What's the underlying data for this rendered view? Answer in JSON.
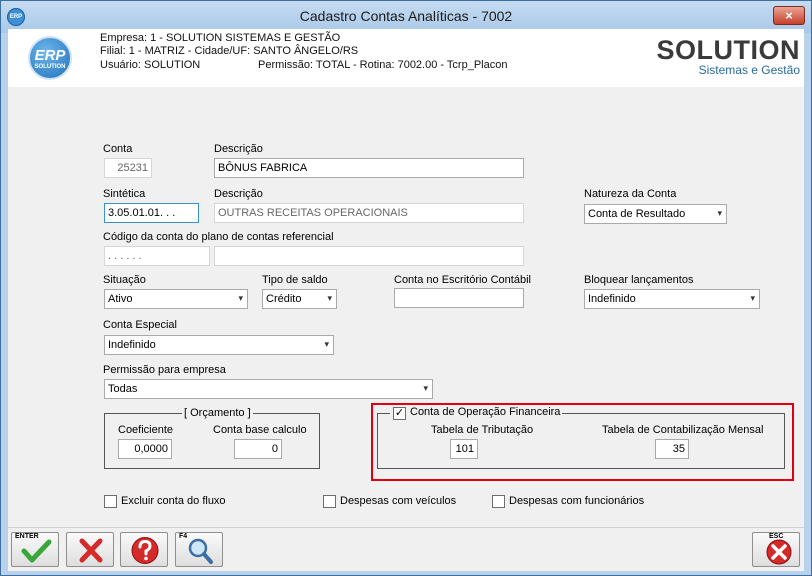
{
  "window": {
    "title": "Cadastro Contas Analíticas - 7002",
    "close_label": "×",
    "app_icon": "ERP"
  },
  "header": {
    "logo_line1": "ERP",
    "logo_line2": "SOLUTION",
    "empresa": "Empresa: 1 - SOLUTION SISTEMAS E GESTÃO",
    "filial": "Filial: 1 - MATRIZ - Cidade/UF: SANTO ÂNGELO/RS",
    "usuario": "Usuário: SOLUTION",
    "permissao": "Permissão: TOTAL - Rotina: 7002.00 - Tcrp_Placon",
    "brand_big": "SOLUTION",
    "brand_small": "Sistemas e Gestão"
  },
  "form": {
    "conta_label": "Conta",
    "conta_value": "25231",
    "descricao_label": "Descrição",
    "descricao_value": "BÔNUS FABRICA",
    "sintetica_label": "Sintética",
    "sintetica_value": "3.05.01.01.  . .",
    "descricao2_label": "Descrição",
    "descricao2_value": "OUTRAS RECEITAS OPERACIONAIS",
    "natureza_label": "Natureza da Conta",
    "natureza_value": "Conta de Resultado",
    "codigo_ref_label": "Código da conta do plano de contas referencial",
    "codigo_ref_value": ". . . . . .",
    "codigo_ref_desc": "",
    "situacao_label": "Situação",
    "situacao_value": "Ativo",
    "tipo_saldo_label": "Tipo de saldo",
    "tipo_saldo_value": "Crédito",
    "conta_escritorio_label": "Conta no Escritório Contábil",
    "conta_escritorio_value": "",
    "bloquear_label": "Bloquear lançamentos",
    "bloquear_value": "Indefinido",
    "conta_especial_label": "Conta Especial",
    "conta_especial_value": "Indefinido",
    "permissao_empresa_label": "Permissão para empresa",
    "permissao_empresa_value": "Todas"
  },
  "orcamento": {
    "title": "[ Orçamento ]",
    "coeficiente_label": "Coeficiente",
    "coeficiente_value": "0,0000",
    "conta_base_label": "Conta base calculo",
    "conta_base_value": "0"
  },
  "financeira": {
    "checkbox_label": "Conta de Operação Financeira",
    "checked": true,
    "tabela_trib_label": "Tabela de Tributação",
    "tabela_trib_value": "101",
    "tabela_contab_label": "Tabela de Contabilização Mensal",
    "tabela_contab_value": "35"
  },
  "options": {
    "excluir_fluxo": "Excluir conta do fluxo",
    "despesas_veiculos": "Despesas com veículos",
    "despesas_funcionarios": "Despesas com funcionários"
  },
  "toolbar": {
    "enter_key": "ENTER",
    "f4_key": "F4",
    "esc_key": "ESC"
  },
  "colors": {
    "accent": "#e0000f",
    "titlebar": "#b9d1ea",
    "ok_green": "#3aa63a",
    "cancel_red": "#d42a2a"
  },
  "chevron": "▾"
}
